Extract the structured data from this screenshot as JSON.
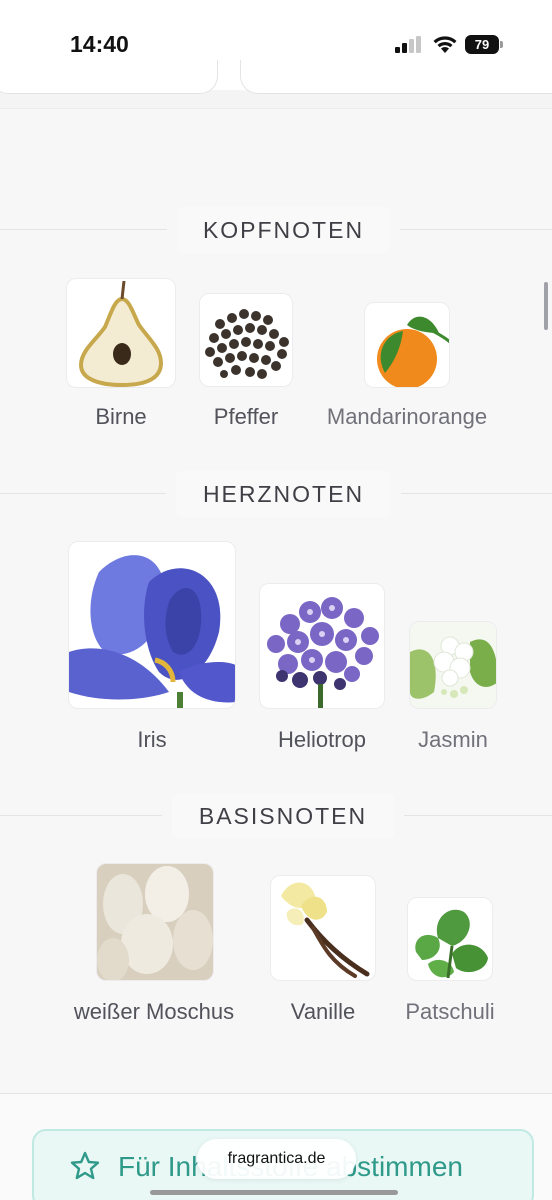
{
  "status_bar": {
    "time": "14:40",
    "battery": "79"
  },
  "sections": {
    "top": {
      "title": "KOPFNOTEN",
      "notes": [
        {
          "label": "Birne",
          "icon": "pear-image"
        },
        {
          "label": "Pfeffer",
          "icon": "pepper-image"
        },
        {
          "label": "Mandarinorange",
          "icon": "mandarin-image"
        }
      ]
    },
    "heart": {
      "title": "HERZNOTEN",
      "notes": [
        {
          "label": "Iris",
          "icon": "iris-image"
        },
        {
          "label": "Heliotrop",
          "icon": "heliotrope-image"
        },
        {
          "label": "Jasmin",
          "icon": "jasmine-image"
        }
      ]
    },
    "base": {
      "title": "BASISNOTEN",
      "notes": [
        {
          "label": "weißer Moschus",
          "icon": "white-musk-image"
        },
        {
          "label": "Vanille",
          "icon": "vanilla-image"
        },
        {
          "label": "Patschuli",
          "icon": "patchouli-image"
        }
      ]
    }
  },
  "vote_button": {
    "label": "Für Inhaltsstoffe abstimmen",
    "icon": "star-icon",
    "color": "#2f9a8a"
  },
  "browser": {
    "url": "fragrantica.de"
  }
}
